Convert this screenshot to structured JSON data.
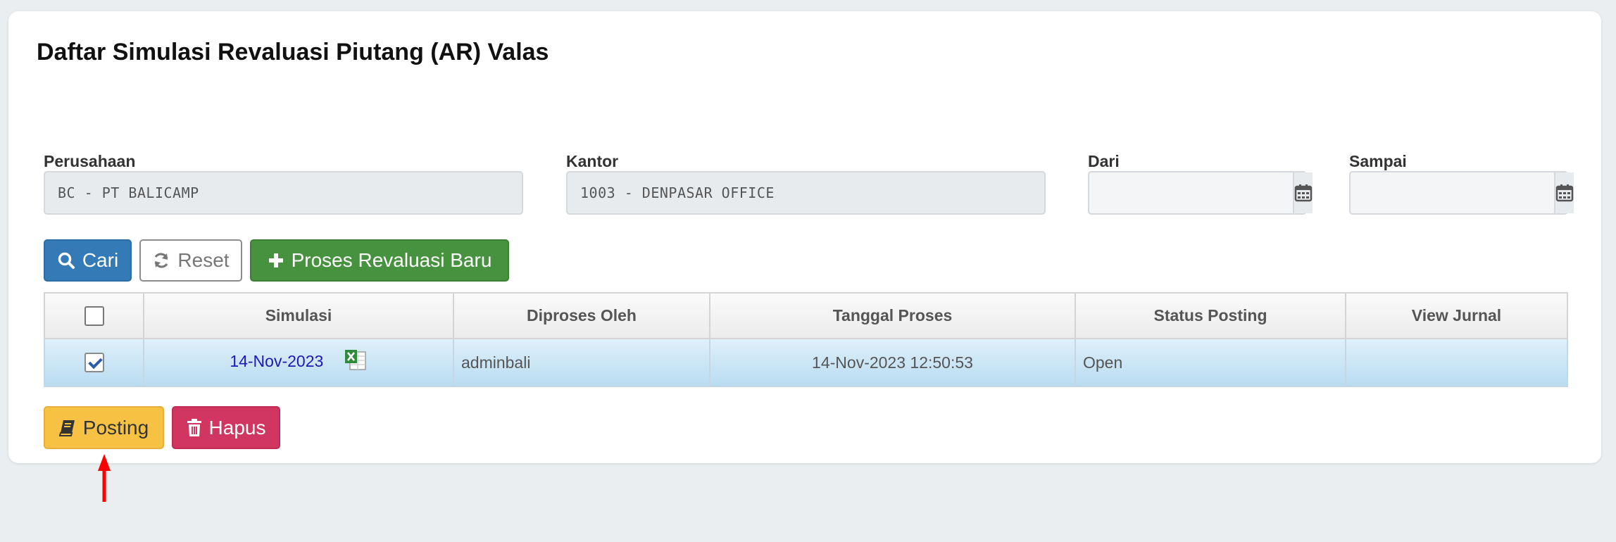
{
  "page": {
    "title": "Daftar Simulasi Revaluasi Piutang (AR) Valas"
  },
  "filters": {
    "perusahaan": {
      "label": "Perusahaan",
      "value": "BC - PT BALICAMP"
    },
    "kantor": {
      "label": "Kantor",
      "value": "1003 - DENPASAR OFFICE"
    },
    "dari": {
      "label": "Dari",
      "value": ""
    },
    "sampai": {
      "label": "Sampai",
      "value": ""
    }
  },
  "buttons": {
    "cari": "Cari",
    "reset": "Reset",
    "proses_baru": "Proses Revaluasi Baru",
    "posting": "Posting",
    "hapus": "Hapus"
  },
  "table": {
    "headers": [
      "Simulasi",
      "Diproses Oleh",
      "Tanggal Proses",
      "Status Posting",
      "View Jurnal"
    ],
    "rows": [
      {
        "checked": true,
        "simulasi": "14-Nov-2023",
        "diproses_oleh": "adminbali",
        "tanggal_proses": "14-Nov-2023 12:50:53",
        "status_posting": "Open",
        "view_jurnal": ""
      }
    ]
  },
  "icons": {
    "cari": "search-icon",
    "reset": "refresh-icon",
    "proses_baru": "plus-icon",
    "posting": "book-icon",
    "hapus": "trash-icon",
    "date": "calendar-icon",
    "export": "excel-icon",
    "annotation": "red-arrow"
  },
  "colors": {
    "primary": "#337ab7",
    "success": "#47923f",
    "warning": "#f7c143",
    "danger": "#d03660",
    "selected_row": "#c6e3f4",
    "arrow": "#ff0000"
  }
}
